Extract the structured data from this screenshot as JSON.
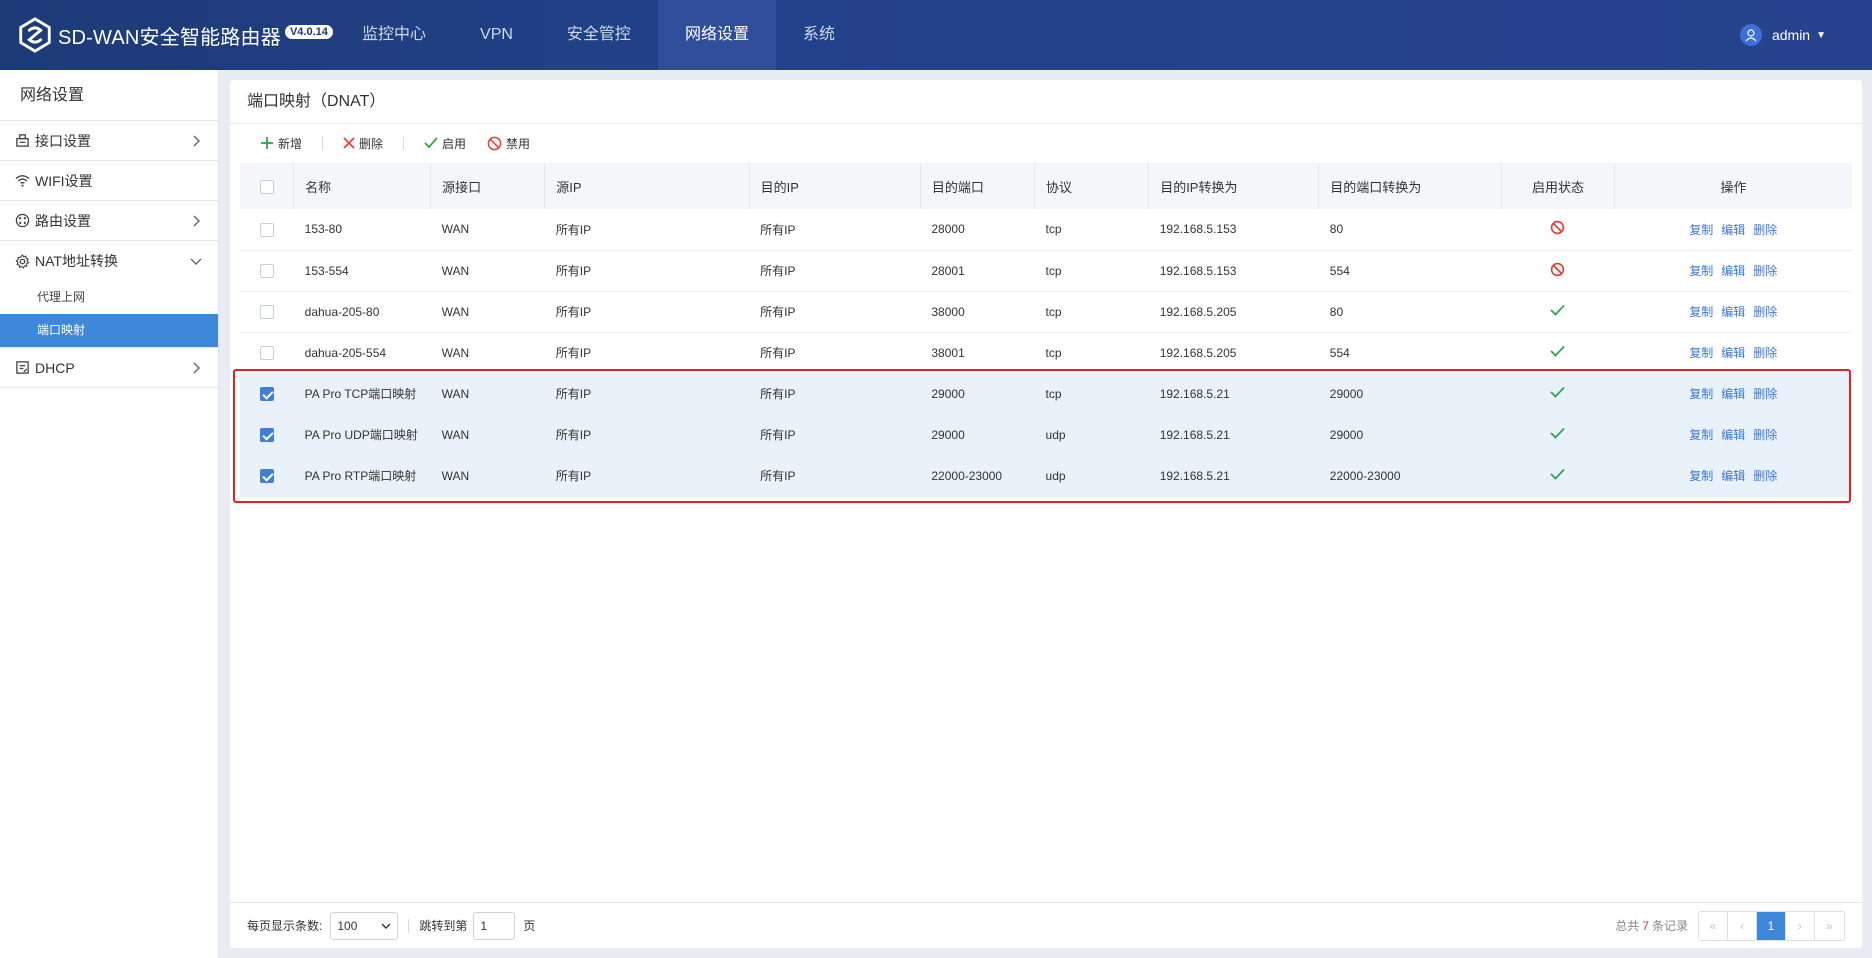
{
  "app": {
    "title": "SD-WAN安全智能路由器",
    "version": "V4.0.14"
  },
  "nav": {
    "items": [
      {
        "label": "监控中心"
      },
      {
        "label": "VPN"
      },
      {
        "label": "安全管控"
      },
      {
        "label": "网络设置",
        "active": true
      },
      {
        "label": "系统"
      }
    ]
  },
  "user": {
    "name": "admin"
  },
  "sidebar": {
    "title": "网络设置",
    "items": [
      {
        "label": "接口设置",
        "icon": "interface-icon"
      },
      {
        "label": "WIFI设置",
        "icon": "wifi-icon"
      },
      {
        "label": "路由设置",
        "icon": "route-icon"
      },
      {
        "label": "NAT地址转换",
        "icon": "gear-icon",
        "expanded": true
      },
      {
        "label": "DHCP",
        "icon": "dhcp-icon"
      }
    ],
    "nat_sub": [
      {
        "label": "代理上网"
      },
      {
        "label": "端口映射",
        "active": true
      }
    ]
  },
  "panel": {
    "title": "端口映射（DNAT）"
  },
  "toolbar": {
    "add": "新增",
    "delete": "删除",
    "enable": "启用",
    "disable": "禁用"
  },
  "table": {
    "headers": [
      "名称",
      "源接口",
      "源IP",
      "目的IP",
      "目的端口",
      "协议",
      "目的IP转换为",
      "目的端口转换为",
      "启用状态",
      "操作"
    ],
    "rows": [
      {
        "checked": false,
        "name": "153-80",
        "src_if": "WAN",
        "src_ip": "所有IP",
        "dst_ip": "所有IP",
        "dst_port": "28000",
        "proto": "tcp",
        "to_ip": "192.168.5.153",
        "to_port": "80",
        "enabled": false
      },
      {
        "checked": false,
        "name": "153-554",
        "src_if": "WAN",
        "src_ip": "所有IP",
        "dst_ip": "所有IP",
        "dst_port": "28001",
        "proto": "tcp",
        "to_ip": "192.168.5.153",
        "to_port": "554",
        "enabled": false
      },
      {
        "checked": false,
        "name": "dahua-205-80",
        "src_if": "WAN",
        "src_ip": "所有IP",
        "dst_ip": "所有IP",
        "dst_port": "38000",
        "proto": "tcp",
        "to_ip": "192.168.5.205",
        "to_port": "80",
        "enabled": true
      },
      {
        "checked": false,
        "name": "dahua-205-554",
        "src_if": "WAN",
        "src_ip": "所有IP",
        "dst_ip": "所有IP",
        "dst_port": "38001",
        "proto": "tcp",
        "to_ip": "192.168.5.205",
        "to_port": "554",
        "enabled": true
      },
      {
        "checked": true,
        "name": "PA Pro TCP端口映射",
        "src_if": "WAN",
        "src_ip": "所有IP",
        "dst_ip": "所有IP",
        "dst_port": "29000",
        "proto": "tcp",
        "to_ip": "192.168.5.21",
        "to_port": "29000",
        "enabled": true
      },
      {
        "checked": true,
        "name": "PA Pro UDP端口映射",
        "src_if": "WAN",
        "src_ip": "所有IP",
        "dst_ip": "所有IP",
        "dst_port": "29000",
        "proto": "udp",
        "to_ip": "192.168.5.21",
        "to_port": "29000",
        "enabled": true
      },
      {
        "checked": true,
        "name": "PA Pro RTP端口映射",
        "src_if": "WAN",
        "src_ip": "所有IP",
        "dst_ip": "所有IP",
        "dst_port": "22000-23000",
        "proto": "udp",
        "to_ip": "192.168.5.21",
        "to_port": "22000-23000",
        "enabled": true
      }
    ],
    "ops": {
      "copy": "复制",
      "edit": "编辑",
      "delete": "删除"
    }
  },
  "footer": {
    "page_size_label": "每页显示条数:",
    "page_size": "100",
    "jump_label": "跳转到第",
    "jump_value": "1",
    "page_unit": "页",
    "total_prefix": "总共",
    "total_count": "7",
    "total_suffix": "条记录",
    "current_page": "1"
  },
  "colors": {
    "topbar": "#1d3b77",
    "accent": "#3f87db",
    "link": "#3b78d8",
    "enabled": "#2ea44f",
    "disabled": "#e53935",
    "highlight": "#e82020"
  }
}
